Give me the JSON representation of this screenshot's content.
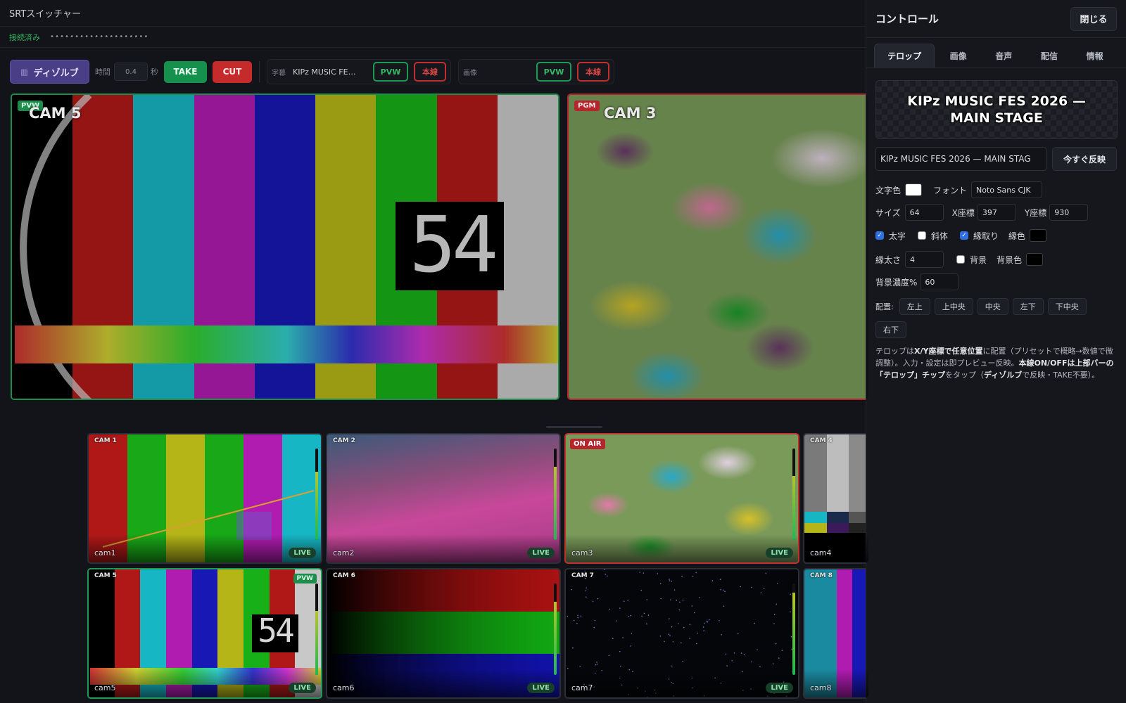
{
  "app": {
    "title": "SRTスイッチャー",
    "connection_status": "接続済み",
    "connection_key": "••••••••••••••••••••"
  },
  "toolbar": {
    "dissolve_label": "ディゾルブ",
    "time_label": "時間",
    "time_value": "0.4",
    "time_unit": "秒",
    "take_label": "TAKE",
    "cut_label": "CUT",
    "caption_chip": {
      "label": "字幕",
      "value": "KIPz MUSIC FE…",
      "pvw": "PVW",
      "onair": "本線"
    },
    "image_chip": {
      "label": "画像",
      "value": "",
      "pvw": "PVW",
      "onair": "本線"
    }
  },
  "monitors": {
    "preview": {
      "badge": "PVW",
      "title": "CAM 5"
    },
    "program": {
      "badge": "PGM",
      "title": "CAM 3"
    },
    "clock_digits": "54"
  },
  "multiview": [
    {
      "label": "CAM 1",
      "name": "cam1",
      "status": "LIVE",
      "audio_level": 0.75
    },
    {
      "label": "CAM 2",
      "name": "cam2",
      "status": "LIVE",
      "audio_level": 0.8
    },
    {
      "label": "ON AIR",
      "name": "cam3",
      "status": "LIVE",
      "audio_level": 0.7
    },
    {
      "label": "CAM 4",
      "name": "cam4",
      "status": "",
      "audio_level": 0
    },
    {
      "label": "CAM 5",
      "name": "cam5",
      "status": "LIVE",
      "tally": "PVW",
      "audio_level": 0.7
    },
    {
      "label": "CAM 6",
      "name": "cam6",
      "status": "LIVE",
      "audio_level": 0.8
    },
    {
      "label": "CAM 7",
      "name": "cam7",
      "status": "LIVE",
      "audio_level": 0.9
    },
    {
      "label": "CAM 8",
      "name": "cam8",
      "status": "",
      "audio_level": 0
    }
  ],
  "panel": {
    "title": "コントロール",
    "close_label": "閉じる",
    "tabs": [
      "テロップ",
      "画像",
      "音声",
      "配信",
      "情報"
    ],
    "active_tab": "テロップ",
    "preview_text": "KIPz MUSIC FES 2026 — MAIN STAGE",
    "text_input": "KIPz MUSIC FES 2026 — MAIN STAG",
    "apply_label": "今すぐ反映",
    "text_color_label": "文字色",
    "text_color": "#ffffff",
    "font_label": "フォント",
    "font_value": "Noto Sans CJK",
    "size_label": "サイズ",
    "size_value": "64",
    "x_label": "X座標",
    "x_value": "397",
    "y_label": "Y座標",
    "y_value": "930",
    "bold_label": "太字",
    "bold_checked": true,
    "italic_label": "斜体",
    "italic_checked": false,
    "outline_label": "縁取り",
    "outline_checked": true,
    "outline_color_label": "縁色",
    "outline_color": "#000000",
    "outline_width_label": "縁太さ",
    "outline_width_value": "4",
    "bg_label": "背景",
    "bg_checked": false,
    "bg_color_label": "背景色",
    "bg_color": "#000000",
    "bg_opacity_label": "背景濃度%",
    "bg_opacity_value": "60",
    "position_label": "配置:",
    "positions": [
      "左上",
      "上中央",
      "中央",
      "左下",
      "下中央",
      "右下"
    ],
    "note_parts": {
      "p1": "テロップは",
      "b1": "X/Y座標で任意位置",
      "p2": "に配置（プリセットで概略→数値で微調整）。入力・設定は即プレビュー反映。",
      "b2": "本線ON/OFFは上部バーの「テロップ」チップ",
      "p3": "をタップ（",
      "b3": "ディゾルブ",
      "p4": "で反映・TAKE不要）。"
    }
  }
}
